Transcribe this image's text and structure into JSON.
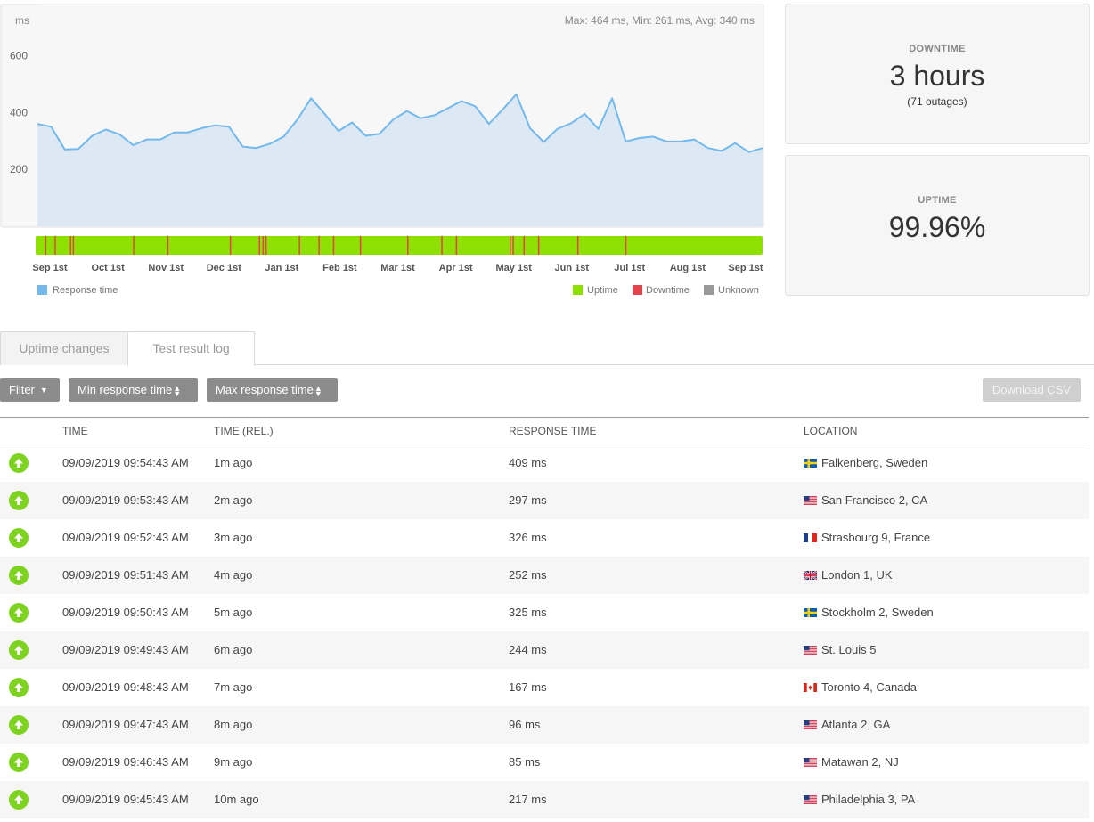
{
  "chart_data": {
    "type": "line",
    "ylabel": "ms",
    "ylim": [
      0,
      780
    ],
    "yticks": [
      200,
      400,
      600
    ],
    "summary": "Max: 464 ms, Min: 261 ms, Avg: 340 ms",
    "series": [
      {
        "name": "Response time",
        "color": "#74b9ec",
        "fill": "#dce9f5",
        "values": [
          360,
          350,
          270,
          272,
          318,
          340,
          323,
          285,
          305,
          305,
          330,
          330,
          345,
          355,
          350,
          280,
          275,
          290,
          315,
          375,
          450,
          395,
          335,
          365,
          318,
          325,
          375,
          405,
          380,
          390,
          415,
          440,
          422,
          360,
          410,
          464,
          345,
          296,
          342,
          362,
          395,
          342,
          450,
          298,
          310,
          315,
          298,
          298,
          305,
          275,
          265,
          292,
          261,
          275
        ]
      }
    ],
    "xticks": [
      "Sep 1st",
      "Oct 1st",
      "Nov 1st",
      "Dec 1st",
      "Jan 1st",
      "Feb 1st",
      "Mar 1st",
      "Apr 1st",
      "May 1st",
      "Jun 1st",
      "Jul 1st",
      "Aug 1st",
      "Sep 1st"
    ],
    "status_bar": {
      "uptime_color": "#8ee000",
      "downtime_color": "#e5424d",
      "unknown_color": "#999999",
      "downtime_marks": [
        0.013,
        0.026,
        0.047,
        0.051,
        0.134,
        0.181,
        0.267,
        0.307,
        0.312,
        0.316,
        0.362,
        0.389,
        0.409,
        0.446,
        0.511,
        0.558,
        0.578,
        0.652,
        0.656,
        0.671,
        0.691,
        0.745,
        0.811
      ]
    },
    "legend": {
      "response_time": "Response time",
      "uptime": "Uptime",
      "downtime": "Downtime",
      "unknown": "Unknown"
    }
  },
  "downtime": {
    "label": "DOWNTIME",
    "value": "3 hours",
    "sub": "(71 outages)"
  },
  "uptime": {
    "label": "UPTIME",
    "value": "99.96%"
  },
  "tabs": [
    {
      "label": "Uptime changes"
    },
    {
      "label": "Test result log"
    }
  ],
  "toolbar": {
    "filter_label": "Filter",
    "min_response_label": "Min response time",
    "max_response_label": "Max response time",
    "download_label": "Download CSV"
  },
  "table": {
    "headers": [
      "TIME",
      "TIME (REL.)",
      "RESPONSE TIME",
      "LOCATION"
    ],
    "rows": [
      {
        "time": "09/09/2019 09:54:43 AM",
        "rel": "1m ago",
        "response": "409 ms",
        "location": "Falkenberg, Sweden",
        "flag": "se"
      },
      {
        "time": "09/09/2019 09:53:43 AM",
        "rel": "2m ago",
        "response": "297 ms",
        "location": "San Francisco 2, CA",
        "flag": "us"
      },
      {
        "time": "09/09/2019 09:52:43 AM",
        "rel": "3m ago",
        "response": "326 ms",
        "location": "Strasbourg 9, France",
        "flag": "fr"
      },
      {
        "time": "09/09/2019 09:51:43 AM",
        "rel": "4m ago",
        "response": "252 ms",
        "location": "London 1, UK",
        "flag": "uk"
      },
      {
        "time": "09/09/2019 09:50:43 AM",
        "rel": "5m ago",
        "response": "325 ms",
        "location": "Stockholm 2, Sweden",
        "flag": "se"
      },
      {
        "time": "09/09/2019 09:49:43 AM",
        "rel": "6m ago",
        "response": "244 ms",
        "location": "St. Louis 5",
        "flag": "us"
      },
      {
        "time": "09/09/2019 09:48:43 AM",
        "rel": "7m ago",
        "response": "167 ms",
        "location": "Toronto 4, Canada",
        "flag": "ca"
      },
      {
        "time": "09/09/2019 09:47:43 AM",
        "rel": "8m ago",
        "response": "96 ms",
        "location": "Atlanta 2, GA",
        "flag": "us"
      },
      {
        "time": "09/09/2019 09:46:43 AM",
        "rel": "9m ago",
        "response": "85 ms",
        "location": "Matawan 2, NJ",
        "flag": "us"
      },
      {
        "time": "09/09/2019 09:45:43 AM",
        "rel": "10m ago",
        "response": "217 ms",
        "location": "Philadelphia 3, PA",
        "flag": "us"
      }
    ]
  }
}
